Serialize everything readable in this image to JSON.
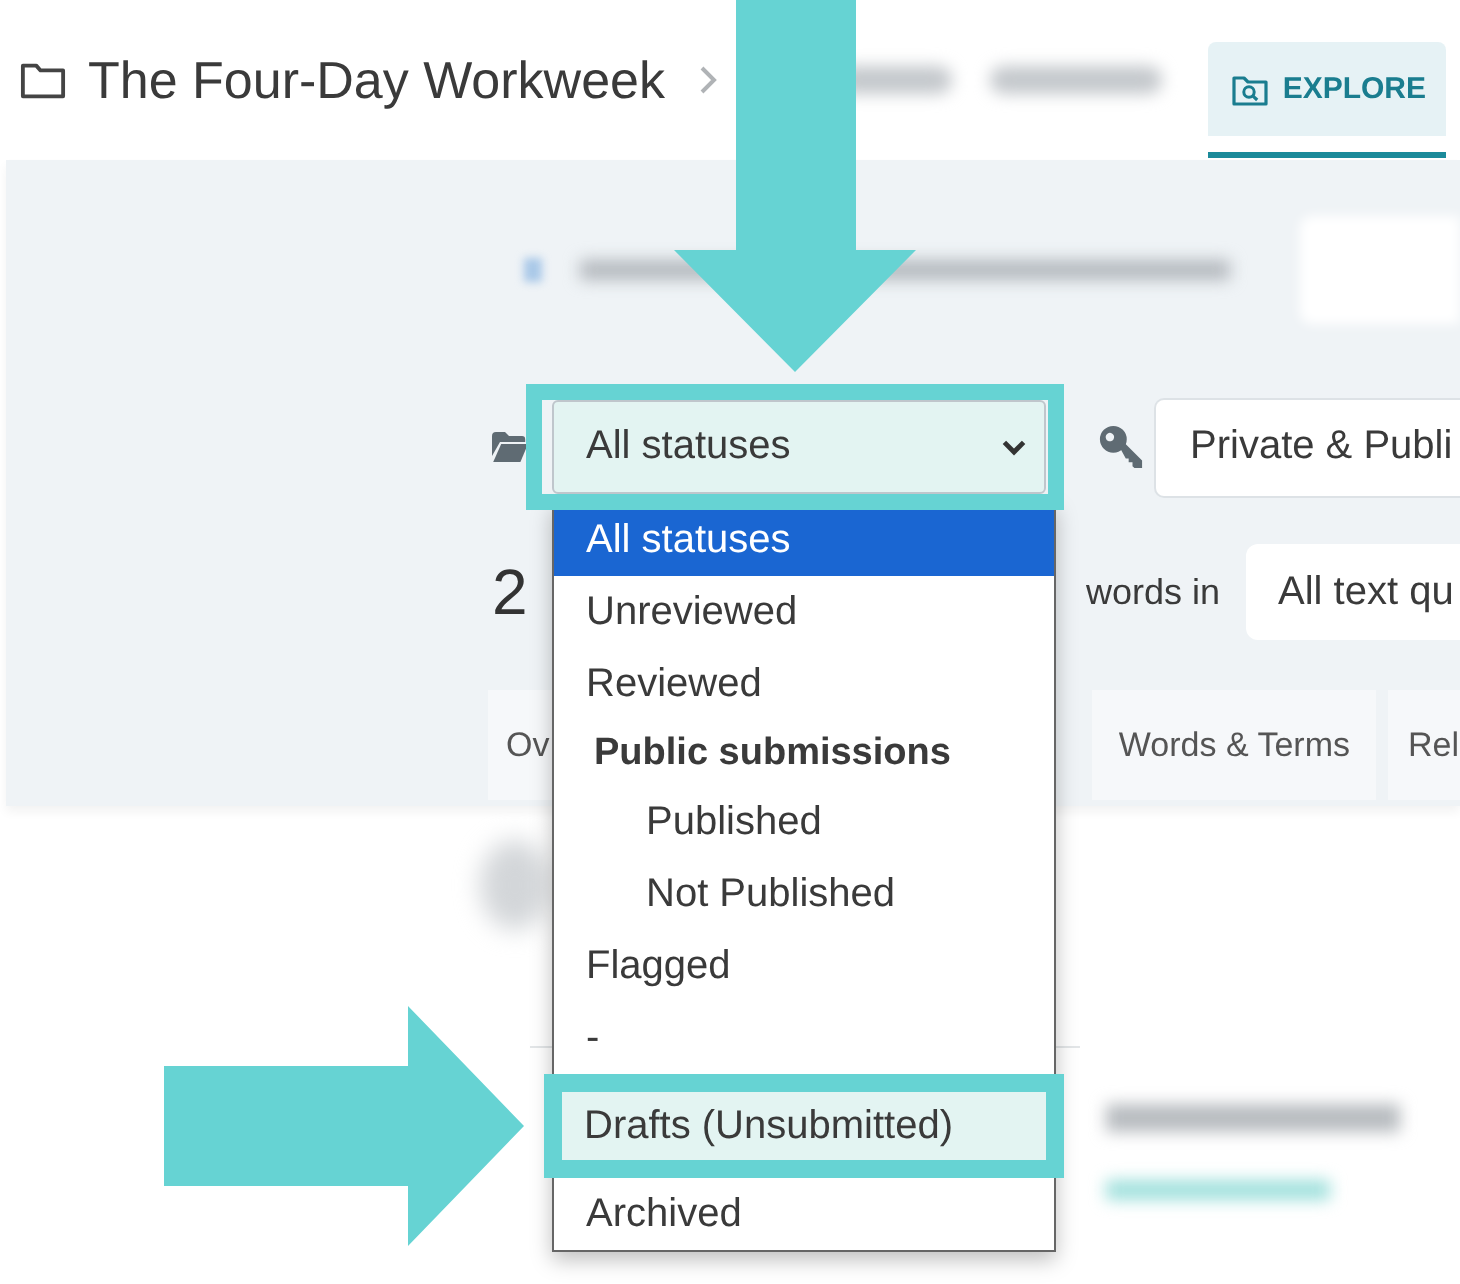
{
  "breadcrumb": {
    "title": "The Four-Day Workweek"
  },
  "nav_tabs": [
    {
      "label": "EXPLORE",
      "selected": true
    }
  ],
  "filters": {
    "status_select": {
      "value": "All statuses",
      "expanded": true,
      "annotated": true,
      "options": [
        {
          "kind": "option",
          "label": "All statuses",
          "selected": true,
          "annotated": false
        },
        {
          "kind": "option",
          "label": "Unreviewed",
          "selected": false,
          "annotated": false
        },
        {
          "kind": "option",
          "label": "Reviewed",
          "selected": false,
          "annotated": false
        },
        {
          "kind": "group",
          "label": "Public submissions",
          "children": [
            {
              "kind": "option",
              "label": "Published",
              "selected": false,
              "annotated": false
            },
            {
              "kind": "option",
              "label": "Not Published",
              "selected": false,
              "annotated": false
            }
          ]
        },
        {
          "kind": "option",
          "label": "Flagged",
          "selected": false,
          "annotated": false
        },
        {
          "kind": "option",
          "label": "-",
          "selected": false,
          "annotated": false
        },
        {
          "kind": "option",
          "label": "Drafts (Unsubmitted)",
          "selected": false,
          "annotated": true
        },
        {
          "kind": "option",
          "label": "Archived",
          "selected": false,
          "annotated": false
        }
      ]
    },
    "visibility_field": {
      "value": "Private & Publi"
    }
  },
  "summary": {
    "count": "2",
    "label": "words in",
    "scope_field": {
      "value": "All text qu"
    }
  },
  "view_tabs": [
    {
      "label": "Ov"
    },
    {
      "label": "Words & Terms"
    },
    {
      "label": "Rel"
    }
  ]
}
